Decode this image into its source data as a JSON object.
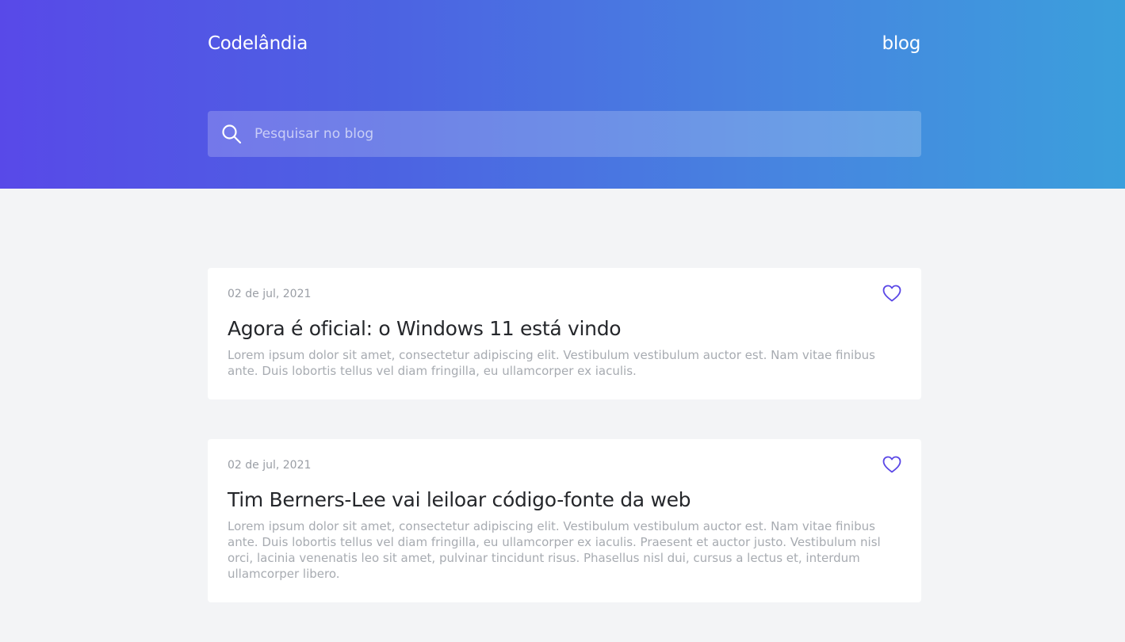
{
  "header": {
    "brand": "Codelândia",
    "nav_label": "blog",
    "search": {
      "placeholder": "Pesquisar no blog",
      "value": "",
      "icon": "search-icon"
    }
  },
  "posts": [
    {
      "date": "02 de jul, 2021",
      "title": "Agora é oficial: o Windows 11 está vindo",
      "excerpt": "Lorem ipsum dolor sit amet, consectetur adipiscing elit. Vestibulum vestibulum auctor est. Nam vitae finibus ante. Duis lobortis tellus vel diam fringilla, eu ullamcorper ex iaculis.",
      "like_icon": "heart-icon"
    },
    {
      "date": "02 de jul, 2021",
      "title": "Tim Berners-Lee vai leiloar código-fonte da web",
      "excerpt": "Lorem ipsum dolor sit amet, consectetur adipiscing elit. Vestibulum vestibulum auctor est. Nam vitae finibus ante. Duis lobortis tellus vel diam fringilla, eu ullamcorper ex iaculis. Praesent et auctor justo. Vestibulum nisl orci, lacinia venenatis leo sit amet, pulvinar tincidunt risus. Phasellus nisl dui, cursus a lectus et, interdum ullamcorper libero.",
      "like_icon": "heart-icon"
    }
  ],
  "colors": {
    "gradient_start": "#5849e8",
    "gradient_end": "#3b9fdc",
    "accent": "#5a47e6",
    "background": "#f3f4f6"
  }
}
